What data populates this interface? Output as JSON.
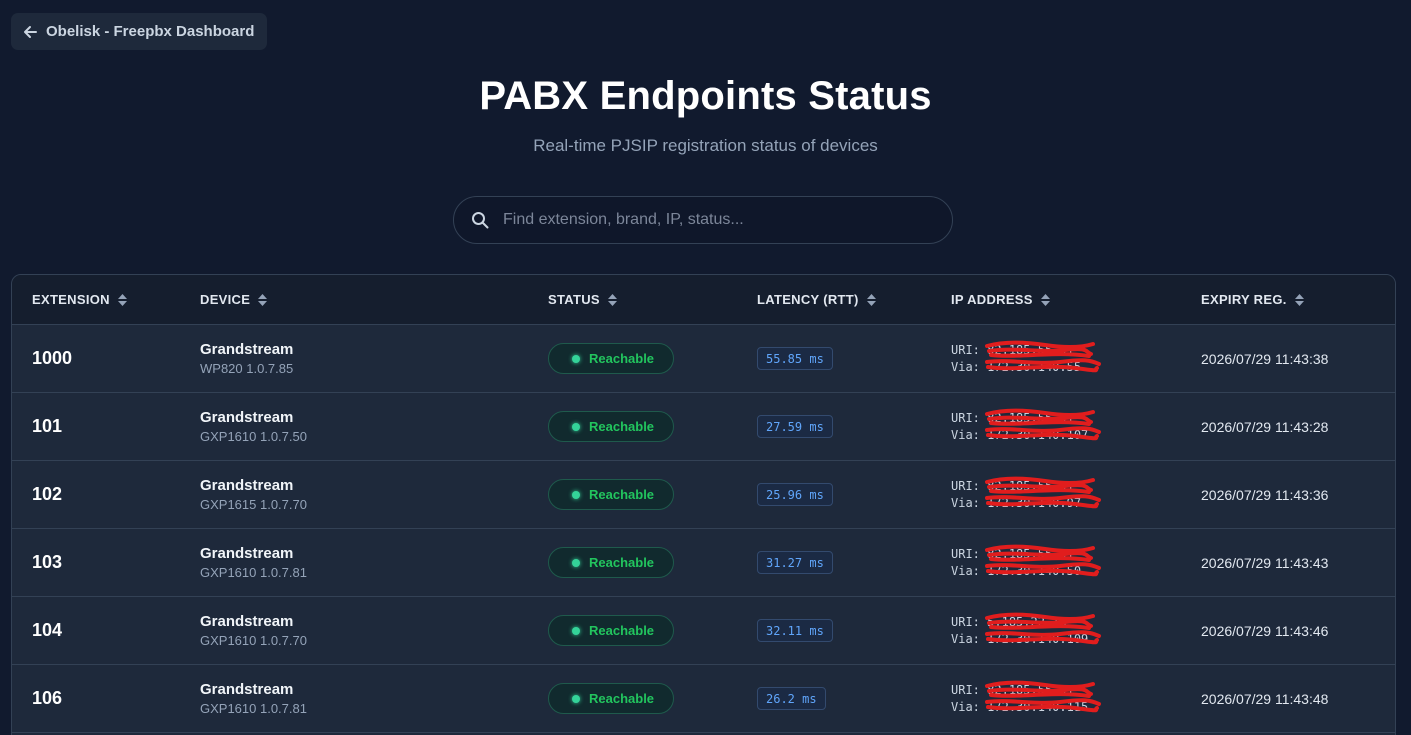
{
  "nav": {
    "back_label": "Obelisk - Freepbx Dashboard"
  },
  "header": {
    "title": "PABX Endpoints Status",
    "subtitle": "Real-time PJSIP registration status of devices"
  },
  "search": {
    "placeholder": "Find extension, brand, IP, status...",
    "value": ""
  },
  "table": {
    "columns": [
      "EXTENSION",
      "DEVICE",
      "STATUS",
      "LATENCY (RTT)",
      "IP ADDRESS",
      "EXPIRY REG."
    ],
    "rows": [
      {
        "extension": "1000",
        "brand": "Grandstream",
        "model": "WP820 1.0.7.85",
        "status": "Reachable",
        "latency": "55.85 ms",
        "uri_label": "URI:",
        "uri": "82.185.55.91",
        "via_label": "Via:",
        "via": "172.30.140.55",
        "expiry": "2026/07/29 11:43:38"
      },
      {
        "extension": "101",
        "brand": "Grandstream",
        "model": "GXP1610 1.0.7.50",
        "status": "Reachable",
        "latency": "27.59 ms",
        "uri_label": "URI:",
        "uri": "82.185.55.91",
        "via_label": "Via:",
        "via": "172.30.140.107",
        "expiry": "2026/07/29 11:43:28"
      },
      {
        "extension": "102",
        "brand": "Grandstream",
        "model": "GXP1615 1.0.7.70",
        "status": "Reachable",
        "latency": "25.96 ms",
        "uri_label": "URI:",
        "uri": "82.185.55.91",
        "via_label": "Via:",
        "via": "172.30.140.97",
        "expiry": "2026/07/29 11:43:36"
      },
      {
        "extension": "103",
        "brand": "Grandstream",
        "model": "GXP1610 1.0.7.81",
        "status": "Reachable",
        "latency": "31.27 ms",
        "uri_label": "URI:",
        "uri": "82.185.55.91",
        "via_label": "Via:",
        "via": "172.30.140.50",
        "expiry": "2026/07/29 11:43:43"
      },
      {
        "extension": "104",
        "brand": "Grandstream",
        "model": "GXP1610 1.0.7.70",
        "status": "Reachable",
        "latency": "32.11 ms",
        "uri_label": "URI:",
        "uri": "5.185.22.16",
        "via_label": "Via:",
        "via": "172.30.140.109",
        "expiry": "2026/07/29 11:43:46"
      },
      {
        "extension": "106",
        "brand": "Grandstream",
        "model": "GXP1610 1.0.7.81",
        "status": "Reachable",
        "latency": "26.2 ms",
        "uri_label": "URI:",
        "uri": "82.185.55.91",
        "via_label": "Via:",
        "via": "172.30.140.115",
        "expiry": "2026/07/29 11:43:48"
      }
    ]
  },
  "icons": {
    "back": "arrow-left-icon",
    "search": "search-icon",
    "sort": "sort-icon",
    "status": "status-dot-icon"
  },
  "colors": {
    "accent_green": "#22c55e",
    "latency_blue": "#60a5fa",
    "redaction_red": "#e11d1d",
    "background": "#111a2e"
  }
}
